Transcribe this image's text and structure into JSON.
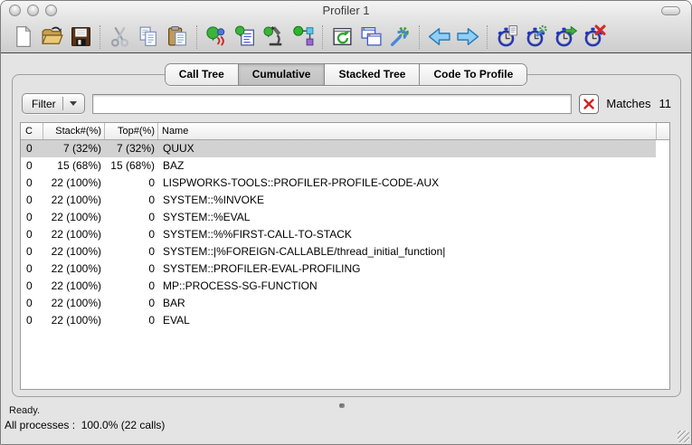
{
  "window": {
    "title": "Profiler 1"
  },
  "titlebar": {
    "traffic_lights": [
      "close-button",
      "minimize-button",
      "zoom-button"
    ],
    "toolbar_toggle": "toolbar-pill-button"
  },
  "toolbar": {
    "groups": [
      [
        "new-document",
        "open-file",
        "save"
      ],
      [
        "cut",
        "copy",
        "paste"
      ],
      [
        "listener",
        "editor",
        "inspector",
        "class-browser"
      ],
      [
        "refresh",
        "clone-window",
        "preferences"
      ],
      [
        "history-back",
        "history-forward"
      ],
      [
        "profile-report",
        "profiler-setup",
        "start-profiling",
        "reset-profiling"
      ]
    ]
  },
  "tabs": {
    "items": [
      {
        "label": "Call Tree",
        "selected": false
      },
      {
        "label": "Cumulative",
        "selected": true
      },
      {
        "label": "Stacked Tree",
        "selected": false
      },
      {
        "label": "Code To Profile",
        "selected": false
      }
    ]
  },
  "filter": {
    "button_label": "Filter",
    "input_value": "",
    "matches_label": "Matches",
    "matches_count": "11"
  },
  "table": {
    "columns": [
      "C",
      "Stack#(%)",
      "Top#(%)",
      "Name"
    ],
    "rows": [
      {
        "c": "0",
        "stack": "7 (32%)",
        "top": "7 (32%)",
        "name": "QUUX",
        "selected": true
      },
      {
        "c": "0",
        "stack": "15 (68%)",
        "top": "15 (68%)",
        "name": "BAZ",
        "selected": false
      },
      {
        "c": "0",
        "stack": "22 (100%)",
        "top": "0",
        "name": "LISPWORKS-TOOLS::PROFILER-PROFILE-CODE-AUX",
        "selected": false
      },
      {
        "c": "0",
        "stack": "22 (100%)",
        "top": "0",
        "name": "SYSTEM::%INVOKE",
        "selected": false
      },
      {
        "c": "0",
        "stack": "22 (100%)",
        "top": "0",
        "name": "SYSTEM::%EVAL",
        "selected": false
      },
      {
        "c": "0",
        "stack": "22 (100%)",
        "top": "0",
        "name": "SYSTEM::%%FIRST-CALL-TO-STACK",
        "selected": false
      },
      {
        "c": "0",
        "stack": "22 (100%)",
        "top": "0",
        "name": "SYSTEM::|%FOREIGN-CALLABLE/thread_initial_function|",
        "selected": false
      },
      {
        "c": "0",
        "stack": "22 (100%)",
        "top": "0",
        "name": "SYSTEM::PROFILER-EVAL-PROFILING",
        "selected": false
      },
      {
        "c": "0",
        "stack": "22 (100%)",
        "top": "0",
        "name": "MP::PROCESS-SG-FUNCTION",
        "selected": false
      },
      {
        "c": "0",
        "stack": "22 (100%)",
        "top": "0",
        "name": "BAR",
        "selected": false
      },
      {
        "c": "0",
        "stack": "22 (100%)",
        "top": "0",
        "name": "EVAL",
        "selected": false
      }
    ]
  },
  "status": {
    "line1": "Ready.",
    "line2": "All processes :  100.0% (22 calls)"
  }
}
